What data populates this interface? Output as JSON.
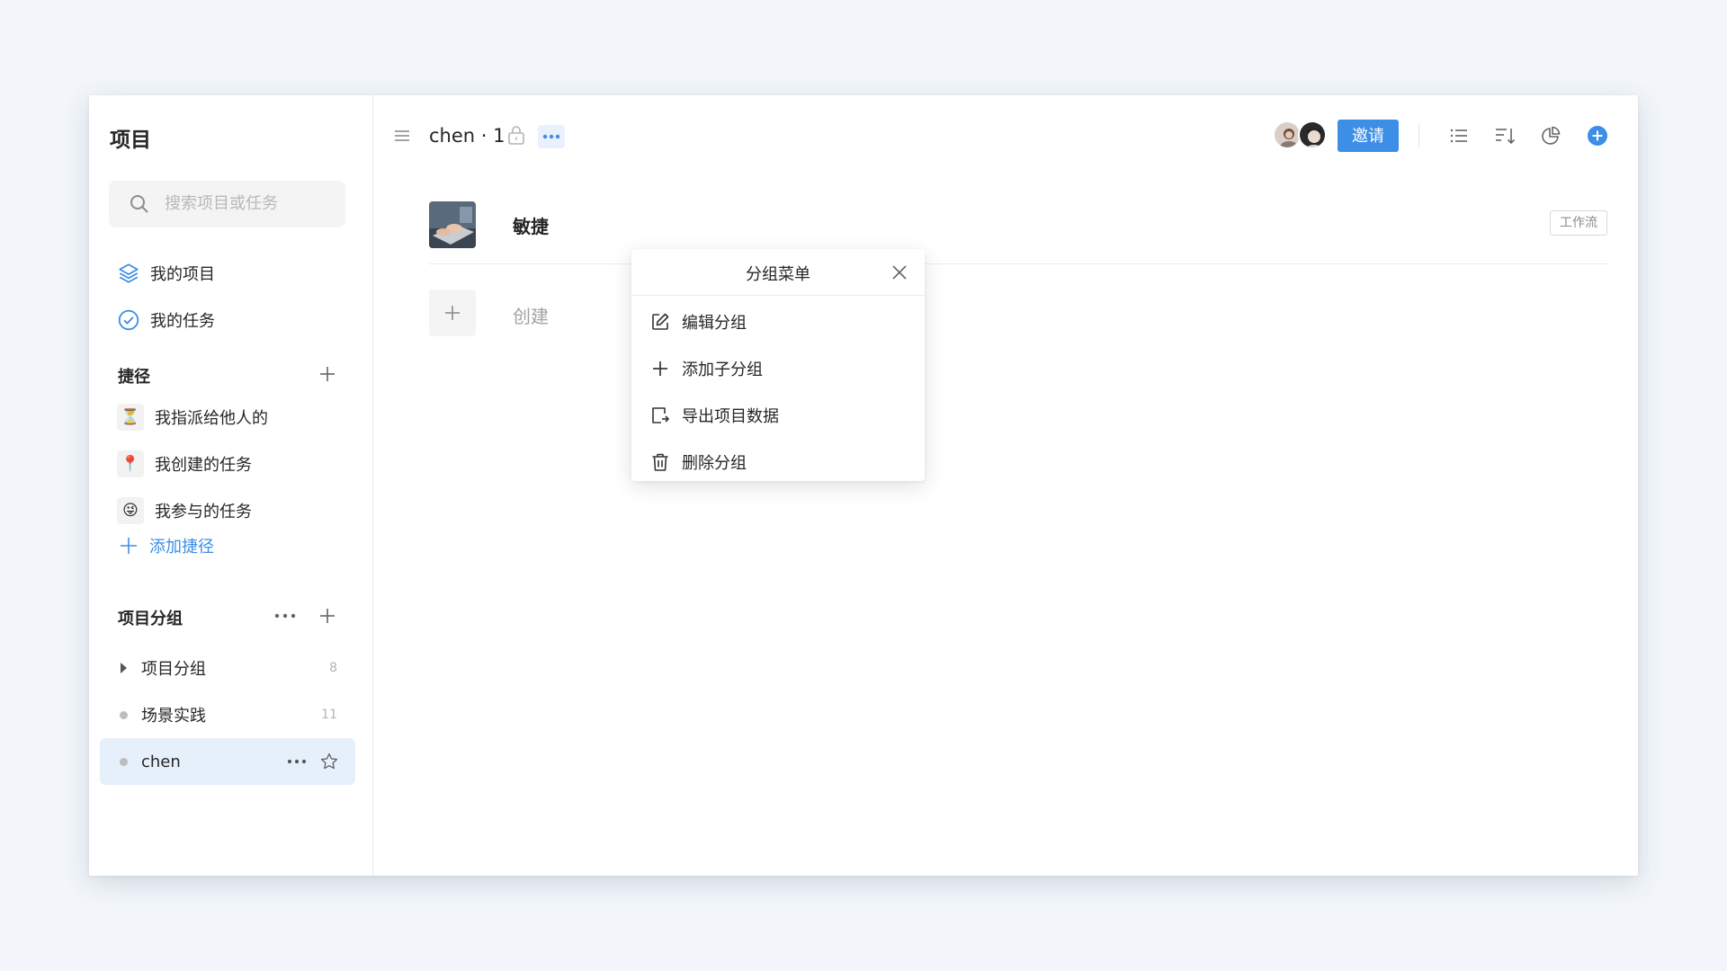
{
  "sidebar": {
    "title": "项目",
    "search": {
      "placeholder": "搜索项目或任务"
    },
    "nav": [
      {
        "label": "我的项目",
        "icon": "layers-icon"
      },
      {
        "label": "我的任务",
        "icon": "check-circle-icon"
      }
    ],
    "shortcuts": {
      "title": "捷径",
      "items": [
        {
          "label": "我指派给他人的",
          "emoji": "⏳"
        },
        {
          "label": "我创建的任务",
          "emoji": "📍"
        },
        {
          "label": "我参与的任务",
          "emoji": "😜"
        }
      ],
      "add_label": "添加捷径"
    },
    "groups": {
      "title": "项目分组",
      "items": [
        {
          "label": "项目分组",
          "count": "8"
        },
        {
          "label": "场景实践",
          "count": "11"
        },
        {
          "label": "chen",
          "count": ""
        }
      ]
    }
  },
  "header": {
    "title": "chen · 1",
    "invite_label": "邀请"
  },
  "main": {
    "task_name": "敏捷",
    "tag": "工作流",
    "create_label": "创建"
  },
  "popover": {
    "title": "分组菜单",
    "items": [
      {
        "label": "编辑分组",
        "icon": "edit-icon"
      },
      {
        "label": "添加子分组",
        "icon": "plus-icon"
      },
      {
        "label": "导出项目数据",
        "icon": "export-icon"
      },
      {
        "label": "删除分组",
        "icon": "trash-icon"
      }
    ]
  },
  "colors": {
    "accent": "#3d8ee6",
    "active_row": "#e6f0fb",
    "background": "#f2f6fa"
  }
}
